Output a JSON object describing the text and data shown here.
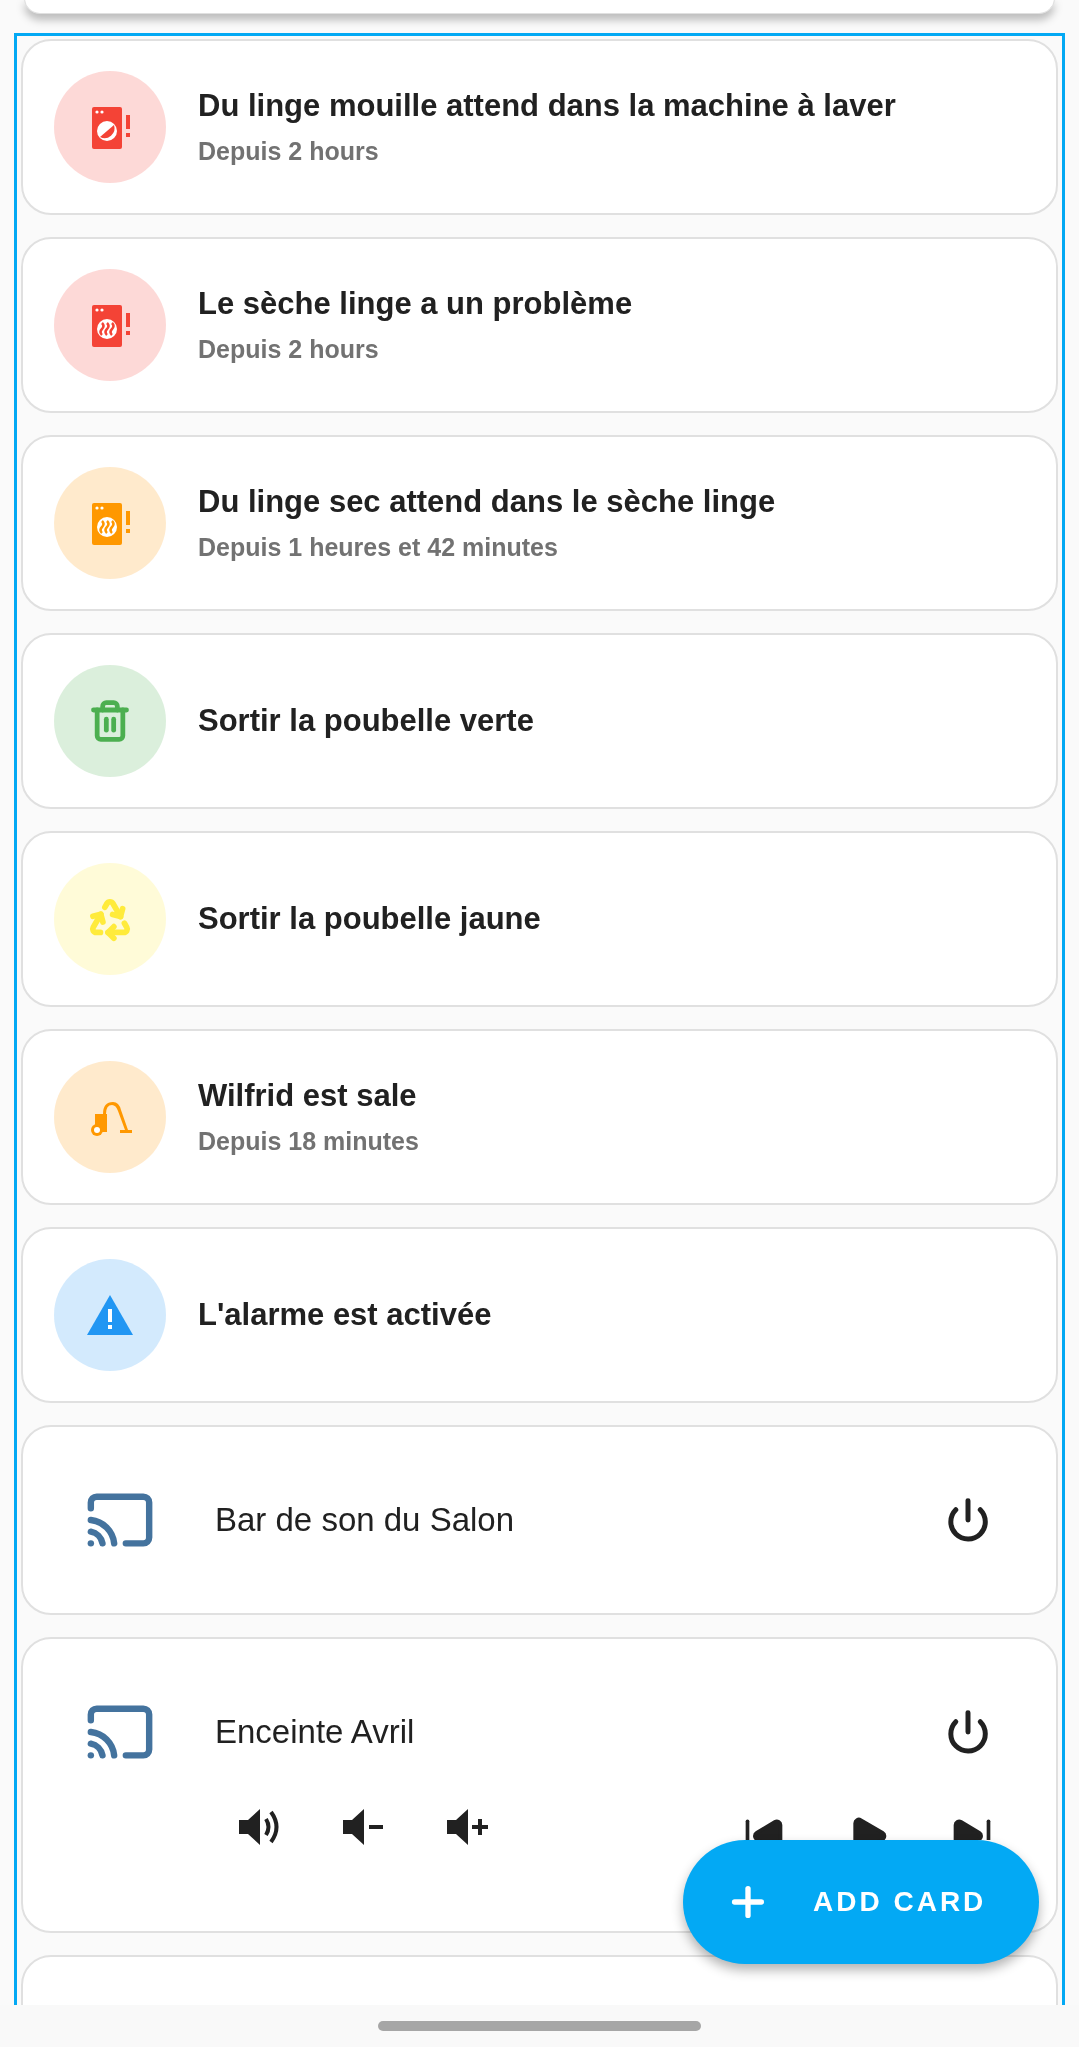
{
  "alerts": [
    {
      "title": "Du linge mouille attend dans la machine à laver",
      "subtitle": "Depuis 2 hours",
      "kind": "washer",
      "color": "#f44336"
    },
    {
      "title": "Le sèche linge a un problème",
      "subtitle": "Depuis 2 hours",
      "kind": "dryer",
      "color": "#f44336"
    },
    {
      "title": "Du linge sec attend dans le sèche linge",
      "subtitle": "Depuis 1 heures et 42 minutes",
      "kind": "dryer",
      "color": "#ff9800"
    },
    {
      "title": "Sortir la poubelle verte",
      "kind": "trash",
      "color": "#4caf50"
    },
    {
      "title": "Sortir la poubelle jaune",
      "kind": "recycle",
      "color": "#ffeb3b"
    },
    {
      "title": "Wilfrid est sale",
      "subtitle": "Depuis 18 minutes",
      "kind": "vacuum",
      "color": "#ff9800"
    },
    {
      "title": "L'alarme est activée",
      "kind": "alert",
      "color": "#2196f3"
    }
  ],
  "media_players": [
    {
      "name": "Bar de son du Salon",
      "kind": "basic"
    },
    {
      "name": "Enceinte Avril",
      "kind": "full"
    }
  ],
  "fab": {
    "label": "ADD CARD"
  }
}
